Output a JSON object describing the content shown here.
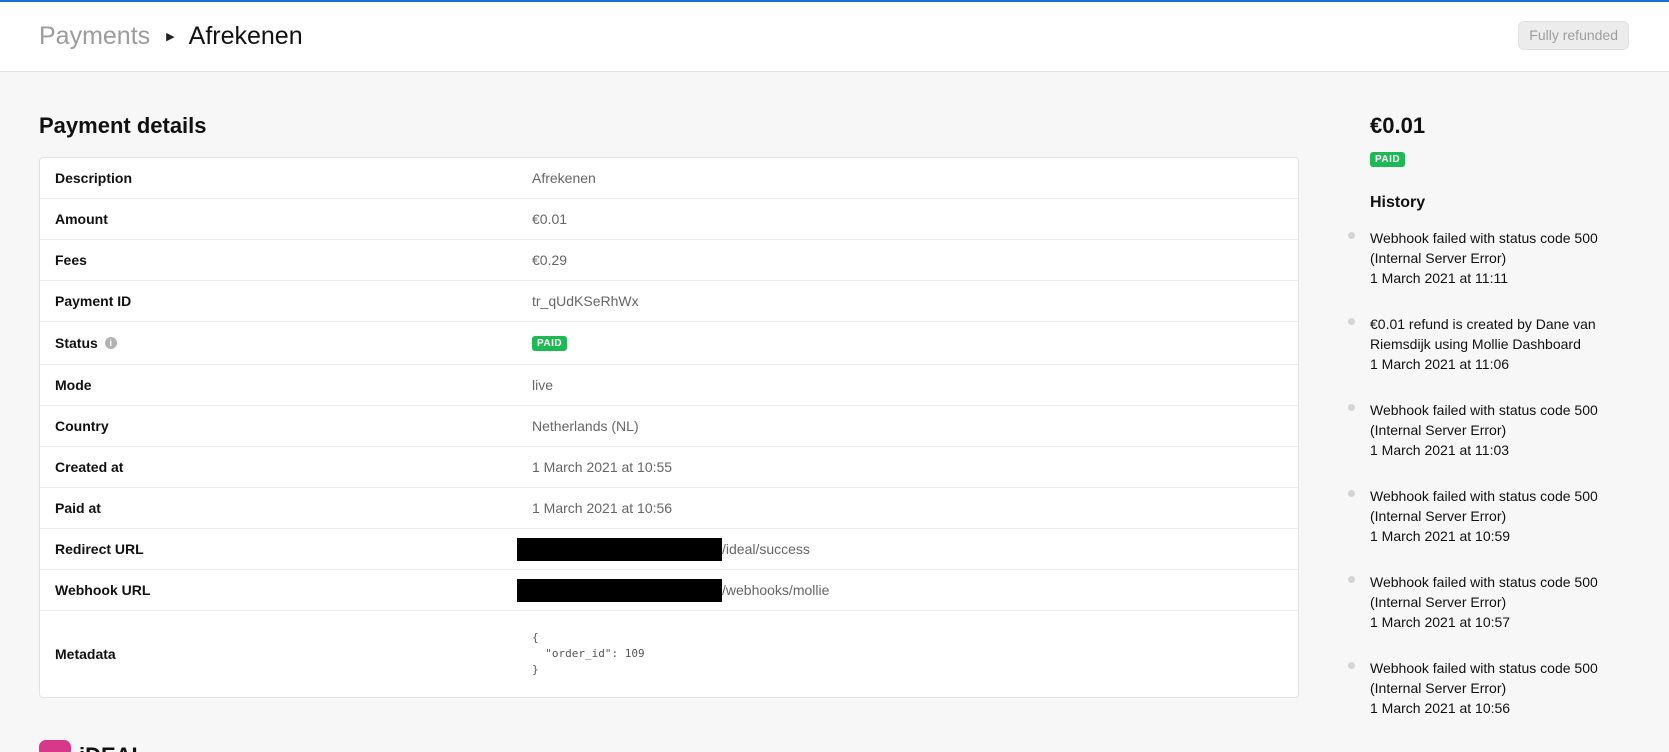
{
  "header": {
    "breadcrumb_parent": "Payments",
    "breadcrumb_current": "Afrekenen",
    "refund_button": "Fully refunded"
  },
  "details": {
    "title": "Payment details",
    "rows": {
      "description": {
        "label": "Description",
        "value": "Afrekenen"
      },
      "amount": {
        "label": "Amount",
        "value": "€0.01"
      },
      "fees": {
        "label": "Fees",
        "value": "€0.29"
      },
      "payment_id": {
        "label": "Payment ID",
        "value": "tr_qUdKSeRhWx"
      },
      "status": {
        "label": "Status",
        "value": "PAID"
      },
      "mode": {
        "label": "Mode",
        "value": "live"
      },
      "country": {
        "label": "Country",
        "value": "Netherlands (NL)"
      },
      "created_at": {
        "label": "Created at",
        "value": "1 March 2021 at 10:55"
      },
      "paid_at": {
        "label": "Paid at",
        "value": "1 March 2021 at 10:56"
      },
      "redirect_url": {
        "label": "Redirect URL",
        "value": "/ideal/success"
      },
      "webhook_url": {
        "label": "Webhook URL",
        "value": "/webhooks/mollie"
      },
      "metadata": {
        "label": "Metadata",
        "value": "{\n  \"order_id\": 109\n}"
      }
    }
  },
  "method": {
    "name": "iDEAL"
  },
  "summary": {
    "amount": "€0.01",
    "status": "PAID"
  },
  "history": {
    "title": "History",
    "events": [
      {
        "text": "Webhook failed with status code 500 (Internal Server Error)",
        "date": "1 March 2021 at 11:11"
      },
      {
        "text": "€0.01 refund is created by Dane van Riemsdijk using Mollie Dashboard",
        "date": "1 March 2021 at 11:06"
      },
      {
        "text": "Webhook failed with status code 500 (Internal Server Error)",
        "date": "1 March 2021 at 11:03"
      },
      {
        "text": "Webhook failed with status code 500 (Internal Server Error)",
        "date": "1 March 2021 at 10:59"
      },
      {
        "text": "Webhook failed with status code 500 (Internal Server Error)",
        "date": "1 March 2021 at 10:57"
      },
      {
        "text": "Webhook failed with status code 500 (Internal Server Error)",
        "date": "1 March 2021 at 10:56"
      }
    ]
  },
  "colors": {
    "accent": "#1a6fd9",
    "paid_badge": "#1db954",
    "ideal_brand": "#d7388a"
  }
}
